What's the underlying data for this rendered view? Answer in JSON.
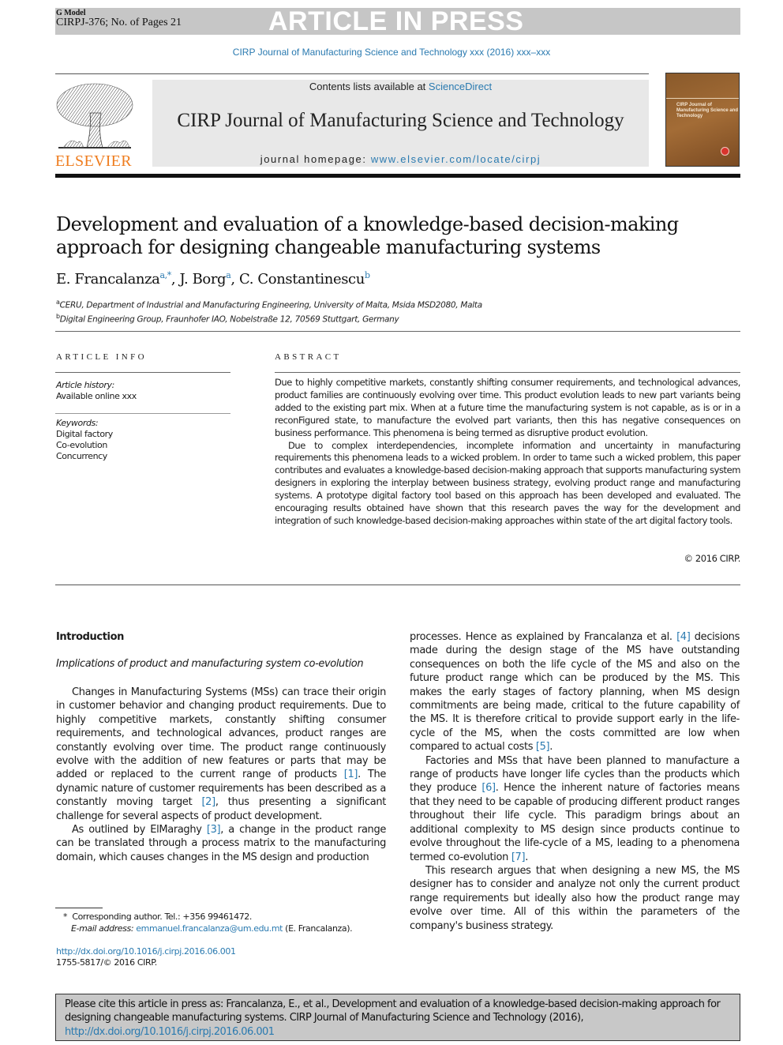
{
  "banner": {
    "g_model": "G Model",
    "manuscript_id": "CIRPJ-376; No. of Pages 21",
    "status": "ARTICLE IN PRESS"
  },
  "journal_ref": "CIRP Journal of Manufacturing Science and Technology xxx (2016) xxx–xxx",
  "journal_header": {
    "publisher_logo": "elsevier-tree-logo",
    "publisher": "ELSEVIER",
    "contents_prefix": "Contents lists available at ",
    "contents_link": "ScienceDirect",
    "journal_title": "CIRP Journal of Manufacturing Science and Technology",
    "homepage_prefix": "journal homepage: ",
    "homepage_link": "www.elsevier.com/locate/cirpj",
    "cover_title": "CIRP Journal of Manufacturing Science and Technology",
    "colors": {
      "publisher_orange": "#ef7d1f",
      "link_blue": "#2a7ab0"
    }
  },
  "article": {
    "title": "Development and evaluation of a knowledge-based decision-making approach for designing changeable manufacturing systems",
    "authors": [
      {
        "name": "E. Francalanza",
        "sup": "a,*"
      },
      {
        "name": "J. Borg",
        "sup": "a"
      },
      {
        "name": "C. Constantinescu",
        "sup": "b"
      }
    ],
    "affiliations": [
      {
        "sup": "a",
        "text": "CERU, Department of Industrial and Manufacturing Engineering, University of Malta, Msida MSD2080, Malta"
      },
      {
        "sup": "b",
        "text": "Digital Engineering Group, Fraunhofer IAO, Nobelstraße 12, 70569 Stuttgart, Germany"
      }
    ]
  },
  "article_info": {
    "heading": "ARTICLE INFO",
    "history_label": "Article history:",
    "history_value": "Available online xxx",
    "keywords_label": "Keywords:",
    "keywords": [
      "Digital factory",
      "Co-evolution",
      "Concurrency"
    ]
  },
  "abstract": {
    "heading": "ABSTRACT",
    "paragraphs": [
      "Due to highly competitive markets, constantly shifting consumer requirements, and technological advances, product families are continuously evolving over time. This product evolution leads to new part variants being added to the existing part mix. When at a future time the manufacturing system is not capable, as is or in a reconFigured state, to manufacture the evolved part variants, then this has negative consequences on business performance. This phenomena is being termed as disruptive product evolution.",
      "Due to complex interdependencies, incomplete information and uncertainty in manufacturing requirements this phenomena leads to a wicked problem. In order to tame such a wicked problem, this paper contributes and evaluates a knowledge-based decision-making approach that supports manufacturing system designers in exploring the interplay between business strategy, evolving product range and manufacturing systems. A prototype digital factory tool based on this approach has been developed and evaluated. The encouraging results obtained have shown that this research paves the way for the development and integration of such knowledge-based decision-making approaches within state of the art digital factory tools."
    ],
    "copyright": "© 2016 CIRP."
  },
  "body": {
    "section_title": "Introduction",
    "subsection_title": "Implications of product and manufacturing system co-evolution",
    "left_paragraphs": [
      {
        "parts": [
          {
            "t": "Changes in Manufacturing Systems (MSs) can trace their origin in customer behavior and changing product requirements. Due to highly competitive markets, constantly shifting consumer requirements, and technological advances, product ranges are constantly evolving over time. The product range continuously evolve with the addition of new features or parts that may be added or replaced to the current range of products "
          },
          {
            "ref": "[1]"
          },
          {
            "t": ". The dynamic nature of customer requirements has been described as a constantly moving target "
          },
          {
            "ref": "[2]"
          },
          {
            "t": ", thus presenting a significant challenge for several aspects of product development."
          }
        ]
      },
      {
        "parts": [
          {
            "t": "As outlined by ElMaraghy "
          },
          {
            "ref": "[3]"
          },
          {
            "t": ", a change in the product range can be translated through a process matrix to the manufacturing domain, which causes changes in the MS design and production"
          }
        ]
      }
    ],
    "right_paragraphs": [
      {
        "continuation": true,
        "parts": [
          {
            "t": "processes. Hence as explained by Francalanza et al. "
          },
          {
            "ref": "[4]"
          },
          {
            "t": " decisions made during the design stage of the MS have outstanding consequences on both the life cycle of the MS and also on the future product range which can be produced by the MS. This makes the early stages of factory planning, when MS design commitments are being made, critical to the future capability of the MS. It is therefore critical to provide support early in the life-cycle of the MS, when the costs committed are low when compared to actual costs "
          },
          {
            "ref": "[5]"
          },
          {
            "t": "."
          }
        ]
      },
      {
        "parts": [
          {
            "t": "Factories and MSs that have been planned to manufacture a range of products have longer life cycles than the products which they produce "
          },
          {
            "ref": "[6]"
          },
          {
            "t": ". Hence the inherent nature of factories means that they need to be capable of producing different product ranges throughout their life cycle. This paradigm brings about an additional complexity to MS design since products continue to evolve throughout the life-cycle of a MS, leading to a phenomena termed co-evolution "
          },
          {
            "ref": "[7]"
          },
          {
            "t": "."
          }
        ]
      },
      {
        "parts": [
          {
            "t": "This research argues that when designing a new MS, the MS designer has to consider and analyze not only the current product range requirements but ideally also how the product range may evolve over time. All of this within the parameters of the company's business strategy."
          }
        ]
      }
    ]
  },
  "footnotes": {
    "corresponding": "Corresponding author. Tel.: +356 99461472.",
    "corresponding_mark": "*",
    "email_label": "E-mail address:",
    "email": "emmanuel.francalanza@um.edu.mt",
    "email_suffix": " (E. Francalanza).",
    "doi": "http://dx.doi.org/10.1016/j.cirpj.2016.06.001",
    "issn": "1755-5817/© 2016 CIRP."
  },
  "cite_box": {
    "text": "Please cite this article in press as: Francalanza, E., et al., Development and evaluation of a knowledge-based decision-making approach for designing changeable manufacturing systems. CIRP Journal of Manufacturing Science and Technology (2016), ",
    "link": "http://dx.doi.org/10.1016/j.cirpj.2016.06.001"
  }
}
